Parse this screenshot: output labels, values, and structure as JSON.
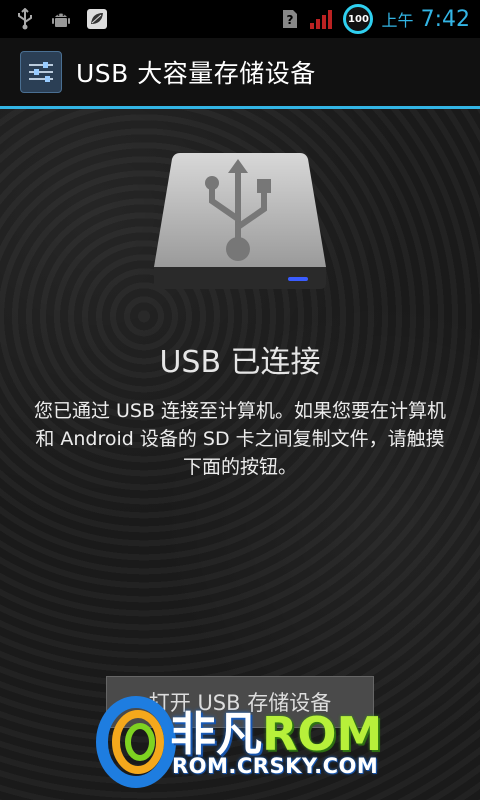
{
  "status_bar": {
    "left_icons": [
      "usb-icon",
      "android-debug-icon",
      "leaf-icon"
    ],
    "right_icons": [
      "sim-unknown-icon",
      "signal-icon"
    ],
    "battery_level": "100",
    "time_prefix": "上午",
    "time": "7:42",
    "accent_color": "#33b5e5"
  },
  "title_bar": {
    "title": "USB 大容量存储设备",
    "icon": "settings-sliders-icon"
  },
  "main": {
    "drive_icon": "usb-drive-icon",
    "heading": "USB 已连接",
    "message": "您已通过 USB 连接至计算机。如果您要在计算机和 Android 设备的 SD 卡之间复制文件，请触摸下面的按钮。",
    "button_label": "打开 USB 存储设备"
  },
  "watermark": {
    "name_cn": "非凡",
    "name_rom": "ROM",
    "url": "ROM.CRSKY.COM"
  }
}
